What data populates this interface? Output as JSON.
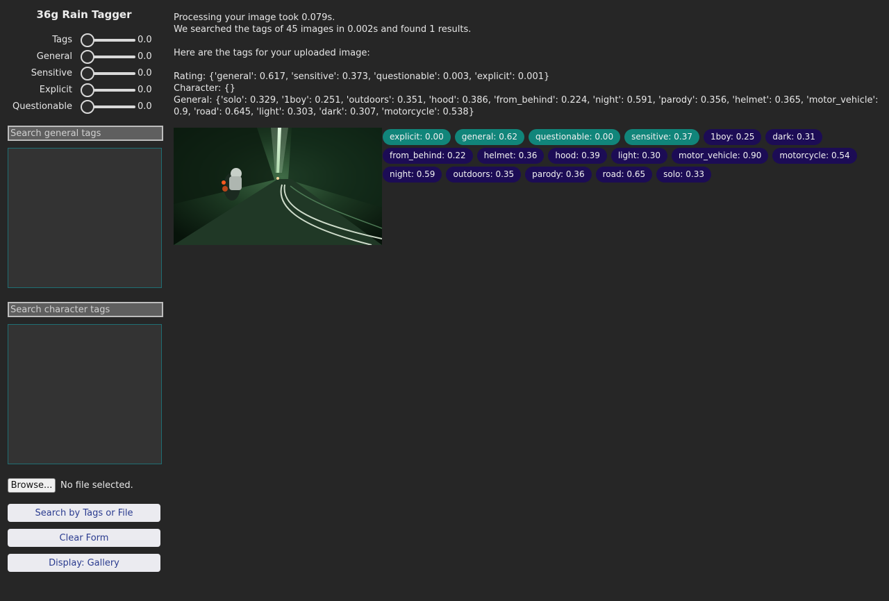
{
  "app_title": "36g Rain Tagger",
  "sliders": [
    {
      "label": "Tags",
      "value": "0.0"
    },
    {
      "label": "General",
      "value": "0.0"
    },
    {
      "label": "Sensitive",
      "value": "0.0"
    },
    {
      "label": "Explicit",
      "value": "0.0"
    },
    {
      "label": "Questionable",
      "value": "0.0"
    }
  ],
  "search_general_placeholder": "Search general tags",
  "search_character_placeholder": "Search character tags",
  "file": {
    "button": "Browse...",
    "status": "No file selected."
  },
  "buttons": {
    "search": "Search by Tags or File",
    "clear": "Clear Form",
    "display": "Display: Gallery"
  },
  "results": {
    "processing": "Processing your image took 0.079s.",
    "searched": "We searched the tags of 45 images in 0.002s and found 1 results.",
    "tags_heading": "Here are the tags for your uploaded image:",
    "rating": "Rating: {'general': 0.617, 'sensitive': 0.373, 'questionable': 0.003, 'explicit': 0.001}",
    "character": "Character: {}",
    "general": "General: {'solo': 0.329, '1boy': 0.251, 'outdoors': 0.351, 'hood': 0.386, 'from_behind': 0.224, 'night': 0.591, 'parody': 0.356, 'helmet': 0.365, 'motor_vehicle': 0.9, 'road': 0.645, 'light': 0.303, 'dark': 0.307, 'motorcycle': 0.538}"
  },
  "chips": [
    {
      "text": "explicit: 0.00",
      "kind": "rating"
    },
    {
      "text": "general: 0.62",
      "kind": "rating"
    },
    {
      "text": "questionable: 0.00",
      "kind": "rating"
    },
    {
      "text": "sensitive: 0.37",
      "kind": "rating"
    },
    {
      "text": "1boy: 0.25",
      "kind": "general"
    },
    {
      "text": "dark: 0.31",
      "kind": "general"
    },
    {
      "text": "from_behind: 0.22",
      "kind": "general"
    },
    {
      "text": "helmet: 0.36",
      "kind": "general"
    },
    {
      "text": "hood: 0.39",
      "kind": "general"
    },
    {
      "text": "light: 0.30",
      "kind": "general"
    },
    {
      "text": "motor_vehicle: 0.90",
      "kind": "general"
    },
    {
      "text": "motorcycle: 0.54",
      "kind": "general"
    },
    {
      "text": "night: 0.59",
      "kind": "general"
    },
    {
      "text": "outdoors: 0.35",
      "kind": "general"
    },
    {
      "text": "parody: 0.36",
      "kind": "general"
    },
    {
      "text": "road: 0.65",
      "kind": "general"
    },
    {
      "text": "solo: 0.33",
      "kind": "general"
    }
  ],
  "colors": {
    "rating_chip": "#11857a",
    "general_chip": "#1c0c55",
    "button_text": "#2a3b8f"
  }
}
